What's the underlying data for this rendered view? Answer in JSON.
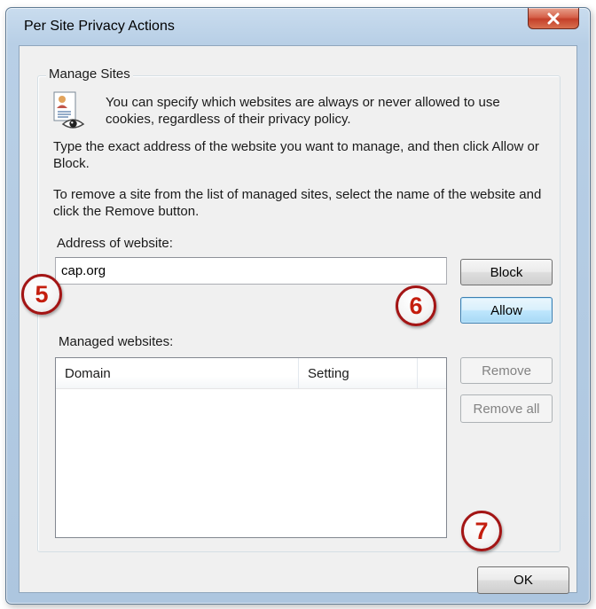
{
  "window": {
    "title": "Per Site Privacy Actions"
  },
  "group": {
    "legend": "Manage Sites",
    "icon": "privacy-document-eye-icon",
    "info_text": "You can specify which websites are always or never allowed to use cookies, regardless of their privacy policy.",
    "instruction_1": "Type the exact address of the website you want to manage, and then click Allow or Block.",
    "instruction_2": "To remove a site from the list of managed sites, select the name of the website and click the Remove button."
  },
  "address": {
    "label": "Address of website:",
    "value": "cap.org"
  },
  "buttons": {
    "block": "Block",
    "allow": "Allow",
    "remove": "Remove",
    "remove_all": "Remove all",
    "ok": "OK"
  },
  "managed": {
    "label": "Managed websites:",
    "columns": [
      "Domain",
      "Setting"
    ],
    "rows": []
  },
  "annotations": {
    "step5": "5",
    "step6": "6",
    "step7": "7"
  },
  "colors": {
    "annotation_red": "#c41e0e",
    "close_button": "#c4402a"
  }
}
